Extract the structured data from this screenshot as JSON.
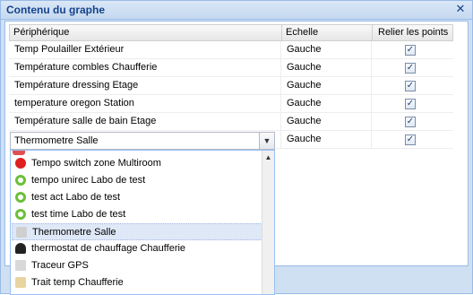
{
  "dialog": {
    "title": "Contenu du graphe",
    "close_icon": "close-icon"
  },
  "grid": {
    "columns": [
      "Périphérique",
      "Echelle",
      "Relier les points"
    ],
    "rows": [
      {
        "device": "Temp Poulailler Extérieur",
        "scale": "Gauche",
        "link": true
      },
      {
        "device": "Température combles Chaufferie",
        "scale": "Gauche",
        "link": true
      },
      {
        "device": "Température dressing Etage",
        "scale": "Gauche",
        "link": true
      },
      {
        "device": "temperature oregon Station",
        "scale": "Gauche",
        "link": true
      },
      {
        "device": "Température salle de bain Etage",
        "scale": "Gauche",
        "link": true
      }
    ],
    "edit_row": {
      "device": "Thermometre Salle",
      "scale": "Gauche",
      "link": true
    }
  },
  "dropdown": {
    "items": [
      {
        "label": "Tempo switch zone Multiroom",
        "icon": "red-dot-icon",
        "color": "#e02020"
      },
      {
        "label": "tempo unirec Labo de test",
        "icon": "green-ring-icon",
        "color": "#6cbf3a"
      },
      {
        "label": "test act Labo de test",
        "icon": "green-ring-icon",
        "color": "#6cbf3a"
      },
      {
        "label": "test time Labo de test",
        "icon": "green-ring-icon",
        "color": "#6cbf3a"
      },
      {
        "label": "Thermometre Salle",
        "icon": "thermometer-device-icon",
        "color": "#bbbbbb",
        "selected": true
      },
      {
        "label": "thermostat de chauffage Chaufferie",
        "icon": "thermostat-icon",
        "color": "#222222"
      },
      {
        "label": "Traceur GPS",
        "icon": "gps-tracker-icon",
        "color": "#d8d8d8"
      },
      {
        "label": "Trait temp Chaufferie",
        "icon": "temp-sensor-icon",
        "color": "#e8d4a0"
      }
    ]
  }
}
